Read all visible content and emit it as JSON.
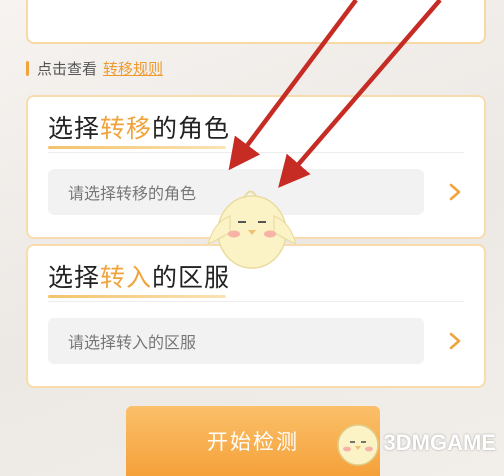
{
  "hint": {
    "text": "点击查看",
    "link": "转移规则"
  },
  "role_card": {
    "title_pre": "选择",
    "title_highlight": "转移",
    "title_post": "的角色",
    "placeholder": "请选择转移的角色"
  },
  "server_card": {
    "title_pre": "选择",
    "title_highlight": "转入",
    "title_post": "的区服",
    "placeholder": "请选择转入的区服"
  },
  "start_button": {
    "label": "开始检测"
  },
  "watermark": {
    "text": "3DMGAME"
  },
  "colors": {
    "accent": "#f0a43c",
    "card_border": "#f8dcae",
    "arrow_red": "#c62b24",
    "field_bg": "#f3f2f2"
  },
  "icons": [
    "chevron-right-icon",
    "red-arrow-annotation",
    "mascot-chick",
    "3dm-logo"
  ]
}
